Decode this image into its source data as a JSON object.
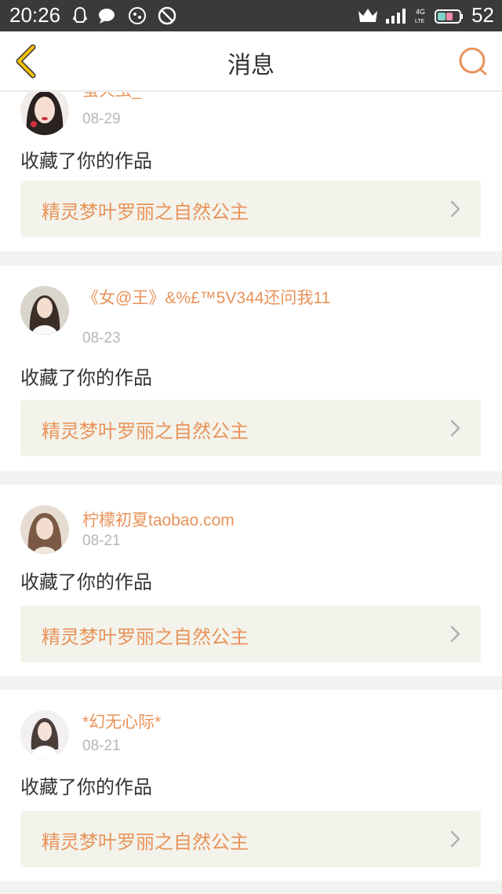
{
  "status_bar": {
    "time": "20:26",
    "battery": "52",
    "network": "4G LTE"
  },
  "nav": {
    "title": "消息"
  },
  "messages": [
    {
      "user": "萤火虫_",
      "date": "08-29",
      "action": "收藏了你的作品",
      "work": "精灵梦叶罗丽之自然公主"
    },
    {
      "user": "《女@王》&%£™5V344还问我11",
      "date": "08-23",
      "action": "收藏了你的作品",
      "work": "精灵梦叶罗丽之自然公主"
    },
    {
      "user": "柠檬初夏taobao.com",
      "date": "08-21",
      "action": "收藏了你的作品",
      "work": "精灵梦叶罗丽之自然公主"
    },
    {
      "user": "*幻无心际*",
      "date": "08-21",
      "action": "收藏了你的作品",
      "work": "精灵梦叶罗丽之自然公主"
    }
  ],
  "colors": {
    "accent": "#e8935a",
    "back_arrow": "#f2c200",
    "work_bg": "#f3f3eb"
  }
}
